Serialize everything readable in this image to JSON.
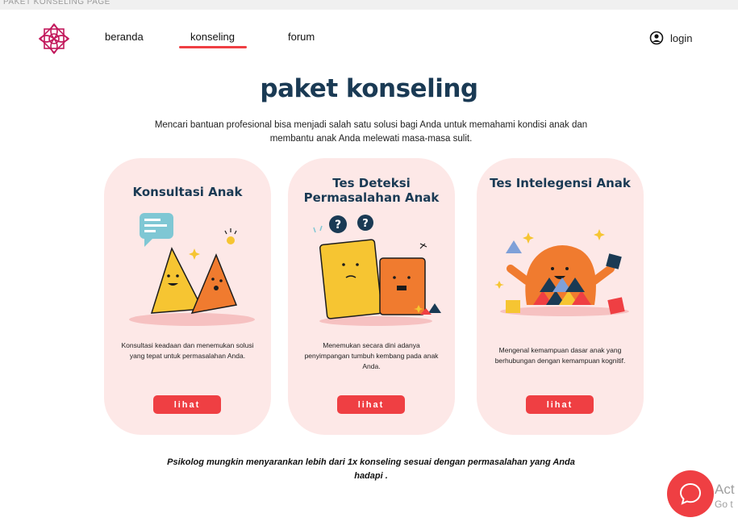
{
  "window": {
    "tab_title": "PAKET KONSELING PAGE"
  },
  "nav": {
    "items": [
      {
        "label": "beranda"
      },
      {
        "label": "konseling"
      },
      {
        "label": "forum"
      }
    ],
    "active": "konseling",
    "login_label": "login"
  },
  "main": {
    "title": "paket konseling",
    "subtitle": "Mencari bantuan profesional bisa menjadi salah satu solusi bagi Anda untuk memahami kondisi anak dan membantu anak Anda melewati masa-masa sulit.",
    "cards": [
      {
        "title": "Konsultasi Anak",
        "description": "Konsultasi keadaan dan menemukan solusi yang tepat untuk permasalahan Anda.",
        "button_label": "lihat"
      },
      {
        "title": "Tes Deteksi Permasalahan Anak",
        "description": "Menemukan secara dini adanya penyimpangan tumbuh kembang pada anak Anda.",
        "button_label": "lihat"
      },
      {
        "title": "Tes Intelegensi Anak",
        "description": "Mengenal kemampuan dasar anak yang berhubungan dengan kemampuan kognitif.",
        "button_label": "lihat"
      }
    ],
    "footer_note": "Psikolog mungkin menyarankan lebih dari 1x konseling sesuai dengan permasalahan yang Anda hadapi ."
  },
  "overlay": {
    "activate_text": "Act",
    "activate_sub": "Go t"
  },
  "colors": {
    "accent": "#ef3f43",
    "title": "#1a3a54",
    "card_bg": "#fde8e7",
    "yellow": "#f6c532",
    "orange": "#f07b2f"
  },
  "icons": [
    "logo-icon",
    "user-circle-icon",
    "chat-bubble-icon"
  ]
}
